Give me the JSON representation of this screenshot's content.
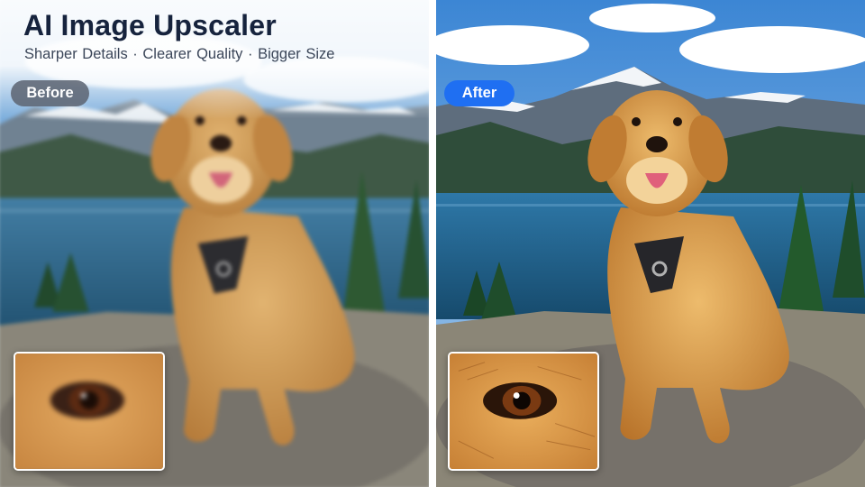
{
  "header": {
    "title": "AI Image Upscaler",
    "subtitle": "Sharper Details  ·  Clearer Quality  ·  Bigger Size"
  },
  "labels": {
    "before": "Before",
    "after": "After"
  },
  "colors": {
    "title": "#16233d",
    "after_badge": "#1f6ff2",
    "before_badge": "#5f6774"
  }
}
